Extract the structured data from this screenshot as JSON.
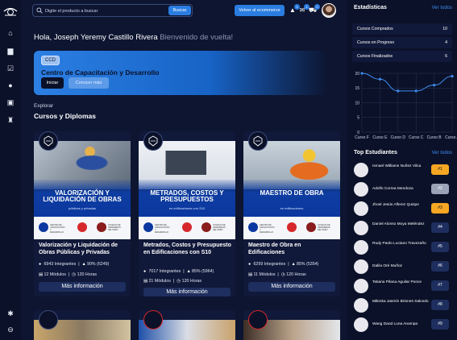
{
  "topbar": {
    "search_placeholder": "Digite el producto a buscar",
    "search_button": "Buscar",
    "ecommerce_button": "Volver al ecommerce",
    "badges": {
      "notifications": "1",
      "messages": "1",
      "cart": "0"
    }
  },
  "greeting": {
    "name": "Hola, Joseph Yeremy Castillo Rivera",
    "welcome": "Bienvenido de vuelta!"
  },
  "banner": {
    "tag": "CCD",
    "title": "Centro de Capacitación y Desarrollo",
    "start_button": "Iniciar",
    "more_button": "Conocer más"
  },
  "section": {
    "explore": "Explorar",
    "title": "Cursos y Diplomas"
  },
  "courses": [
    {
      "thumb_title": "Valorización y Liquidación de Obras",
      "thumb_sub": "públicas y privadas",
      "name": "Valorización y Liquidación de Obras Públicas y Privadas",
      "students": "6943 Integrantes",
      "rating": "90% (6249)",
      "modules": "12 Módulos",
      "hours": "120 Horas",
      "more": "Más información"
    },
    {
      "thumb_title": "Metrados, Costos y Presupuestos",
      "thumb_sub": "en edificaciones con S10",
      "name": "Metrados, Costos y Presupuesto en Edificaciones con S10",
      "students": "7017 Integrantes",
      "rating": "85% (5964)",
      "modules": "21 Módulos",
      "hours": "120 Horas",
      "more": "Más información"
    },
    {
      "thumb_title": "Maestro de Obra",
      "thumb_sub": "en edificaciones",
      "name": "Maestro de Obra en Edificaciones",
      "students": "6299 Integrantes",
      "rating": "85% (5354)",
      "modules": "11 Módulos",
      "hours": "120 Horas",
      "more": "Más información"
    }
  ],
  "logos": {
    "ccd": "CENTRO DE CAPACITACIÓN Y DESARROLLO",
    "cip": "COLEGIO DE INGENIEROS DEL PERÚ"
  },
  "stats": {
    "title": "Estadísticas",
    "view_all": "Ver todos",
    "rows": [
      {
        "label": "Cursos Comprados",
        "value": "10"
      },
      {
        "label": "Cursos en Progreso",
        "value": "4"
      },
      {
        "label": "Cursos Finalizados",
        "value": "6"
      }
    ]
  },
  "chart_data": {
    "type": "line",
    "categories": [
      "Curso F",
      "Curso E",
      "Curso D",
      "Curso C",
      "Curso B",
      "Curso A"
    ],
    "values": [
      20,
      18,
      14,
      14,
      16,
      19
    ],
    "yticks": [
      0,
      5,
      10,
      15,
      20
    ],
    "ylim": [
      0,
      20
    ],
    "grid": true,
    "color": "#3f8cf0"
  },
  "top_students": {
    "title": "Top Estudiantes",
    "view_all": "Ver todos",
    "rows": [
      {
        "name": "Ismael Williams Nuñez Vilca",
        "rank": "#1",
        "color": "#f5a623"
      },
      {
        "name": "Adolfo Correa Mendoza",
        "rank": "#2",
        "color": "#9aa3b8"
      },
      {
        "name": "Jhoel Jesús Alferez Quispe",
        "rank": "#3",
        "color": "#f5a623"
      },
      {
        "name": "Daniel Alonso Moya Meléndez",
        "rank": "#4",
        "color": "#1e2e5e"
      },
      {
        "name": "Rudy Paolo Luciano Travezaño",
        "rank": "#5",
        "color": "#1e2e5e"
      },
      {
        "name": "Dalila Oré Muñoz",
        "rank": "#6",
        "color": "#1e2e5e"
      },
      {
        "name": "Tatiana Pilana Aguilar Ponce",
        "rank": "#7",
        "color": "#1e2e5e"
      },
      {
        "name": "Milenka Jasmín Briones Salcedo",
        "rank": "#8",
        "color": "#1e2e5e"
      },
      {
        "name": "Wang Dand Luna Anampa",
        "rank": "#9",
        "color": "#1e2e5e"
      }
    ]
  }
}
